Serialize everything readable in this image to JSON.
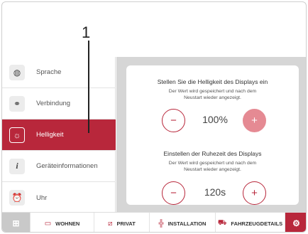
{
  "callout": {
    "number": "1"
  },
  "sidebar": {
    "items": [
      {
        "label": "Sprache",
        "icon": "globe-icon",
        "active": false
      },
      {
        "label": "Verbindung",
        "icon": "link-icon",
        "active": false
      },
      {
        "label": "Helligkeit",
        "icon": "brightness-icon",
        "active": true
      },
      {
        "label": "Geräteinformationen",
        "icon": "info-icon",
        "active": false
      },
      {
        "label": "Uhr",
        "icon": "alarm-clock-icon",
        "active": false
      }
    ]
  },
  "brightness": {
    "title": "Stellen Sie die Helligkeit des Displays ein",
    "subtitle": "Der Wert wird gespeichert und nach dem Neustart wieder angezeigt.",
    "value": "100%",
    "minus": "−",
    "plus": "+"
  },
  "sleep": {
    "title": "Einstellen der Ruhezeit des Displays",
    "subtitle": "Der Wert wird gespeichert und nach dem Neustart wieder angezeigt.",
    "value": "120s",
    "minus": "−",
    "plus": "+"
  },
  "bottombar": {
    "grid_icon": "grid-icon",
    "tabs": [
      {
        "label": "WOHNEN",
        "icon": "sofa-icon"
      },
      {
        "label": "PRIVAT",
        "icon": "private-icon"
      },
      {
        "label": "INSTALLATION",
        "icon": "installation-icon"
      },
      {
        "label": "FAHRZEUGDETAILS",
        "icon": "vehicle-icon"
      }
    ],
    "settings_icon": "gear-icon"
  },
  "colors": {
    "accent": "#b8273b",
    "accent_light": "#e58a93",
    "panel_bg": "#d6d6d6"
  }
}
